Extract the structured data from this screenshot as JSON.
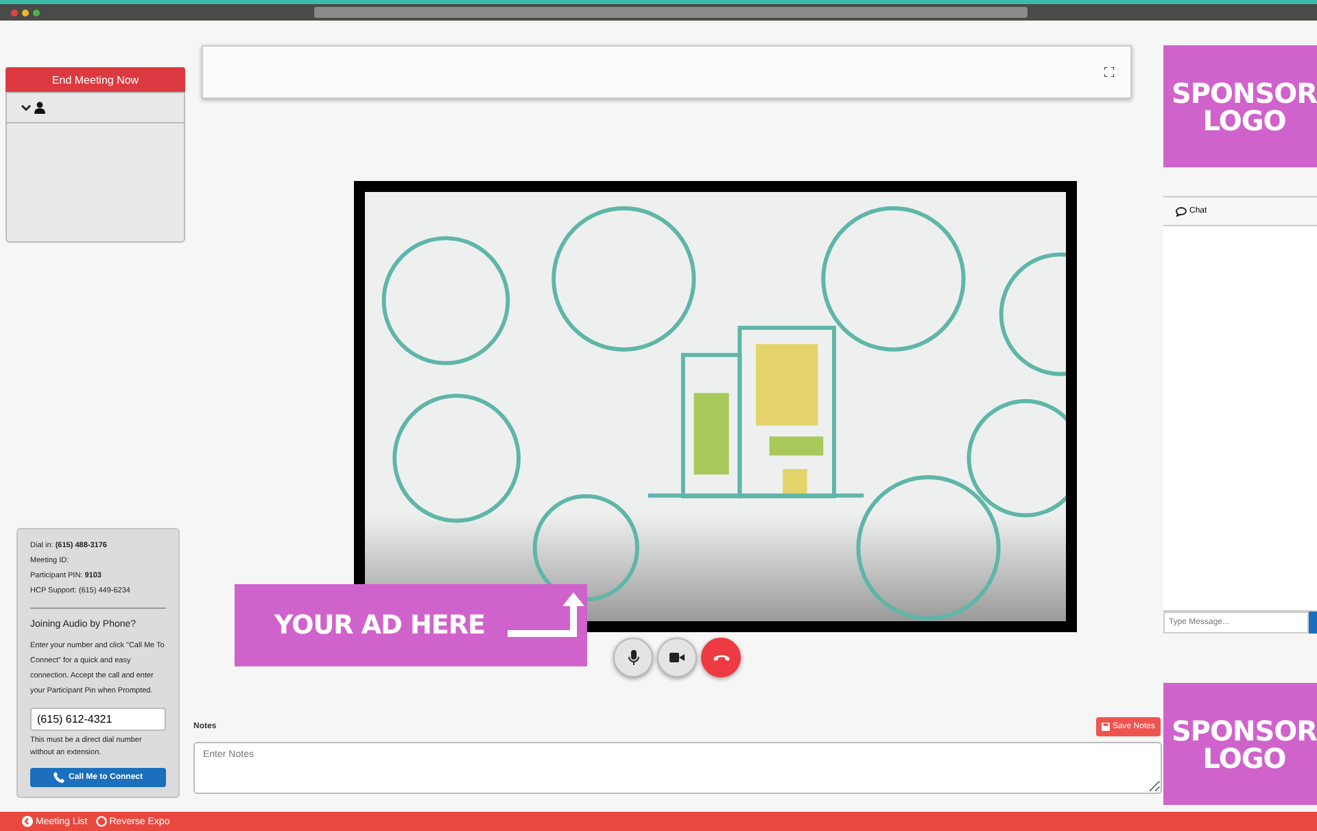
{
  "end_meeting_button": "End Meeting Now",
  "participants": {
    "expanded": true
  },
  "dial_in": {
    "lines": [
      "Dial in: **(615) 488-3176**",
      "Meeting ID:",
      "Participant PIN: **9103**",
      "HCP Support: (615) 449-6234"
    ],
    "heading": "Joining Audio by Phone?",
    "instructions": "Enter your number and click \"Call Me To Connect\" for a quick and easy connection. Accept the call and enter your Participant Pin when Prompted.",
    "phone_value": "(615) 612-4321",
    "note": "This must be a direct dial number without an extension.",
    "button": "Call Me to Connect"
  },
  "video": {
    "kind": "picture"
  },
  "ad_banner": "YOUR AD HERE",
  "call_controls": [
    {
      "kind": "mic"
    },
    {
      "kind": "camera"
    },
    {
      "kind": "hangup"
    }
  ],
  "notes": {
    "label": "Notes",
    "save_button": "Save Notes",
    "placeholder": "Enter Notes"
  },
  "sponsors": [
    "SPONSOR LOGO",
    "SPONSOR LOGO"
  ],
  "chat": {
    "tab": "Chat",
    "placeholder": "Type Message..."
  },
  "footer": {
    "links": [
      {
        "label": "Meeting List",
        "kind": "back"
      },
      {
        "label": "Reverse Expo",
        "kind": "circle"
      }
    ]
  }
}
